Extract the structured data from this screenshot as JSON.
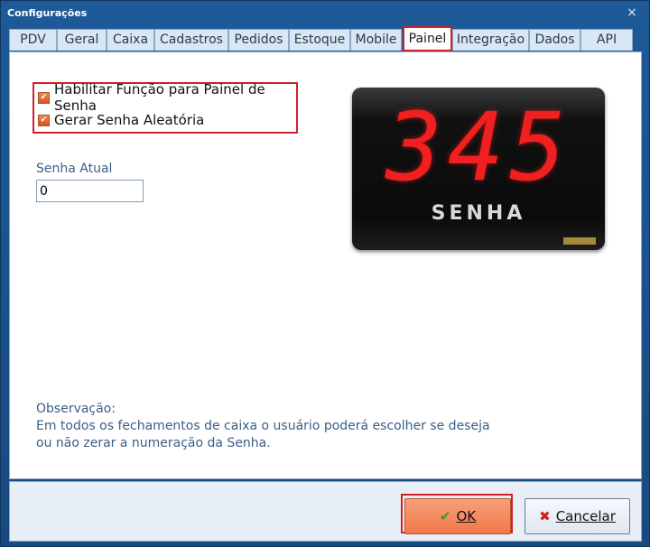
{
  "window": {
    "title": "Configurações",
    "close_icon": "×"
  },
  "tabs": [
    {
      "label": "PDV"
    },
    {
      "label": "Geral"
    },
    {
      "label": "Caixa"
    },
    {
      "label": "Cadastros"
    },
    {
      "label": "Pedidos"
    },
    {
      "label": "Estoque"
    },
    {
      "label": "Mobile"
    },
    {
      "label": "Painel",
      "active": true
    },
    {
      "label": "Integração"
    },
    {
      "label": "Dados"
    },
    {
      "label": "API"
    }
  ],
  "panel": {
    "checkboxes": [
      {
        "label": "Habilitar Função para Painel de Senha",
        "checked": true
      },
      {
        "label": "Gerar Senha Aleatória",
        "checked": true
      }
    ],
    "senha_label": "Senha Atual",
    "senha_value": "0",
    "display": {
      "digits": "345",
      "caption": "SENHA",
      "digit_color": "#f02020"
    },
    "observacao_title": "Observação:",
    "observacao_text": "Em todos os fechamentos de caixa o usuário poderá escolher se deseja ou não zerar a numeração da Senha."
  },
  "buttons": {
    "ok_label": "OK",
    "cancel_label": "Cancelar"
  },
  "colors": {
    "accent_red": "#d0202a",
    "title_bar": "#1e5a98",
    "label_blue": "#3b5e86"
  }
}
